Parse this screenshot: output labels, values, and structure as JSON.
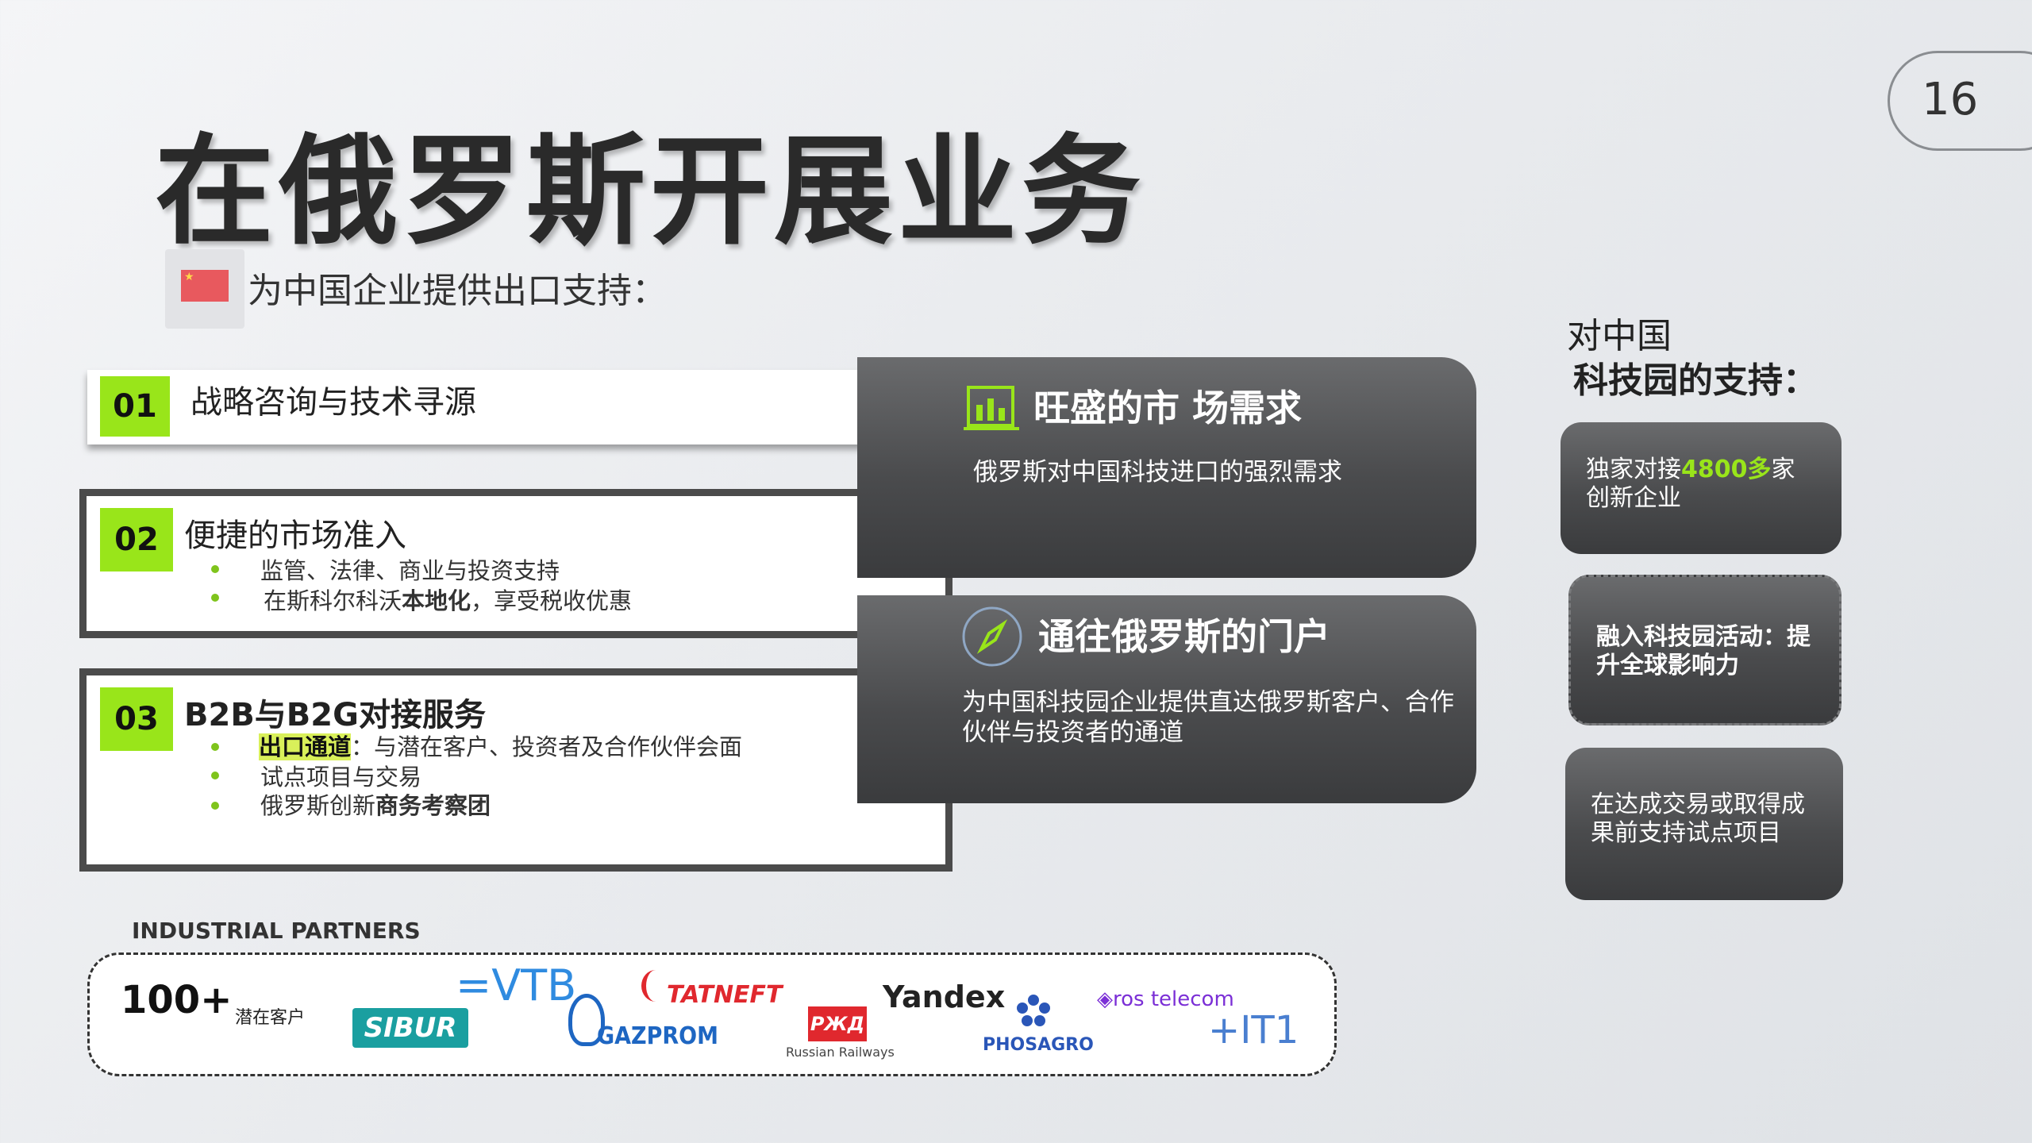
{
  "page_number": "16",
  "title": "在俄罗斯开展业务",
  "subtitle": "为中国企业提供出口支持：",
  "cards": [
    {
      "number": "01",
      "title": "战略咨询与技术寻源"
    },
    {
      "number": "02",
      "title": "便捷的市场准入",
      "bullets": [
        "监管、法律、商业与投资支持",
        "在斯科尔科沃",
        "本地化",
        "，享受税收优惠"
      ]
    },
    {
      "number": "03",
      "title": "B2B与B2G对接服务",
      "bullets": [
        "出口通道",
        "：与潜在客户、投资者及合作伙伴会面",
        "试点项目与交易",
        "俄罗斯创新",
        "商务考察团"
      ]
    }
  ],
  "panels": [
    {
      "title": "旺盛的市 场需求",
      "text": "俄罗斯对中国科技进口的强烈需求"
    },
    {
      "title": "通往俄罗斯的门户",
      "text": "为中国科技园企业提供直达俄罗斯客户、合作伙伴与投资者的通道"
    }
  ],
  "right": {
    "title_line1": "对中国",
    "title_line2": "科技园的支持：",
    "card1_a": "独家对接",
    "card1_b": "4800多",
    "card1_c": "家创新企业",
    "card2": "融入科技园活动：提升全球影响力",
    "card3": "在达成交易或取得成果前支持试点项目"
  },
  "partners": {
    "heading": "INDUSTRIAL PARTNERS",
    "count": "100+",
    "count_label": "潜在客户",
    "logos": [
      "SIBUR",
      "=VTB",
      "GAZPROM",
      "TATNEFT",
      "РЖД",
      "Russian Railways",
      "Yandex",
      "PHOSAGRO",
      "ros telecom",
      "+IT1"
    ]
  },
  "colors": {
    "accent": "#99e51a",
    "dark_panel": "#4a4b4d",
    "highlight": "#d9f05a"
  }
}
